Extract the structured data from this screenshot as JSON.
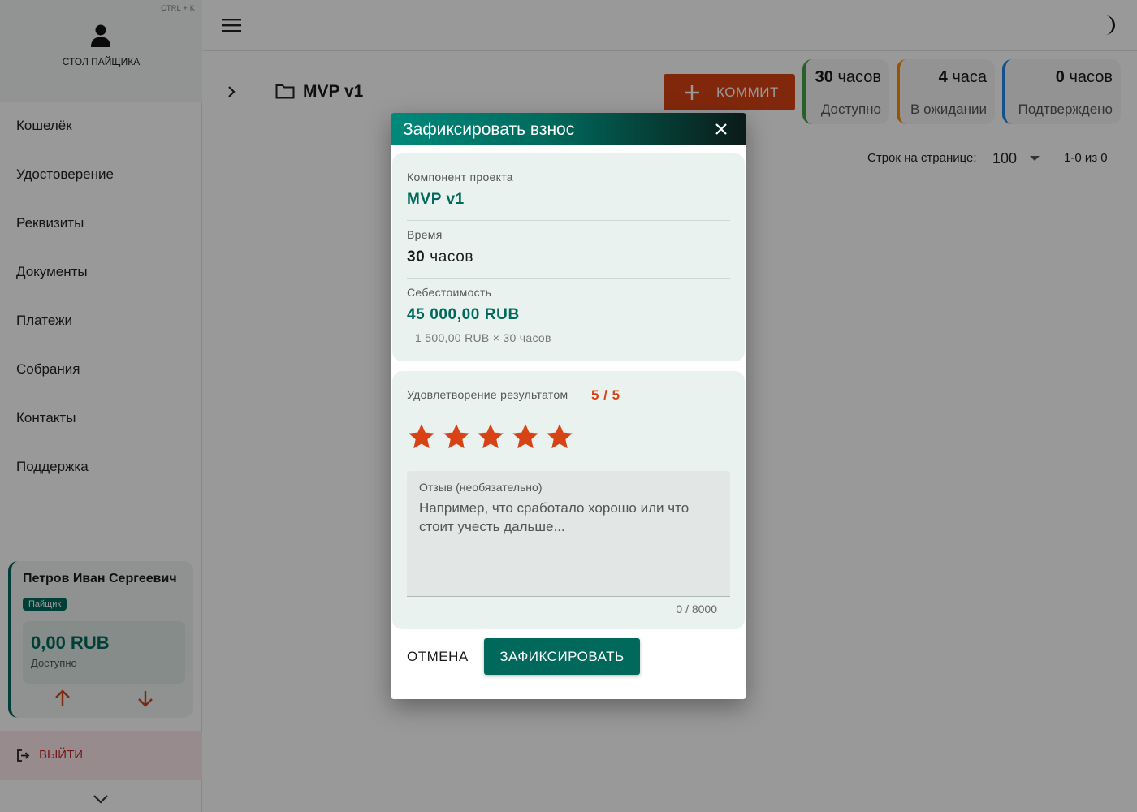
{
  "sidebar": {
    "shortcut": "CTRL + K",
    "desk_label": "СТОЛ ПАЙЩИКА",
    "nav": [
      "Кошелёк",
      "Удостоверение",
      "Реквизиты",
      "Документы",
      "Платежи",
      "Собрания",
      "Контакты",
      "Поддержка"
    ],
    "user": {
      "name": "Петров Иван Сергеевич",
      "role": "Пайщик",
      "balance": "0,00 RUB",
      "balance_label": "Доступно"
    },
    "logout": "ВЫЙТИ"
  },
  "toolbar": {
    "project_title": "MVP v1",
    "commit_label": "КОММИТ"
  },
  "stats": [
    {
      "value": "30",
      "unit": "часов",
      "label": "Доступно",
      "color": "#43a047"
    },
    {
      "value": "4",
      "unit": "часа",
      "label": "В ожидании",
      "color": "#fb8c00"
    },
    {
      "value": "0",
      "unit": "часов",
      "label": "Подтверждено",
      "color": "#1e88e5"
    }
  ],
  "pager": {
    "rows_label": "Строк на странице:",
    "rows_value": "100",
    "range": "1-0 из 0"
  },
  "dialog": {
    "title": "Зафиксировать взнос",
    "component_label": "Компонент проекта",
    "component_value": "MVP v1",
    "time_label": "Время",
    "time_number": "30",
    "time_unit": "часов",
    "cost_label": "Себестоимость",
    "cost_value": "45 000,00 RUB",
    "cost_calc": "1 500,00 RUB × 30 часов",
    "rating_label": "Удовлетворение результатом",
    "rating_text": "5 / 5",
    "rating": 5,
    "rating_max": 5,
    "feedback_label": "Отзыв (необязательно)",
    "feedback_placeholder": "Например, что сработало хорошо или что стоит учесть дальше...",
    "feedback_counter": "0 / 8000",
    "cancel_label": "ОТМЕНА",
    "submit_label": "ЗАФИКСИРОВАТЬ"
  },
  "colors": {
    "primary": "#00695c",
    "accent": "#d84315",
    "logout": "#c62828"
  },
  "icons": [
    "user-icon",
    "menu-icon",
    "moon-icon",
    "chevron-right-icon",
    "folder-icon",
    "plus-icon",
    "close-icon",
    "star-icon",
    "arrow-up-icon",
    "arrow-down-icon",
    "logout-icon",
    "chevron-down-icon"
  ]
}
